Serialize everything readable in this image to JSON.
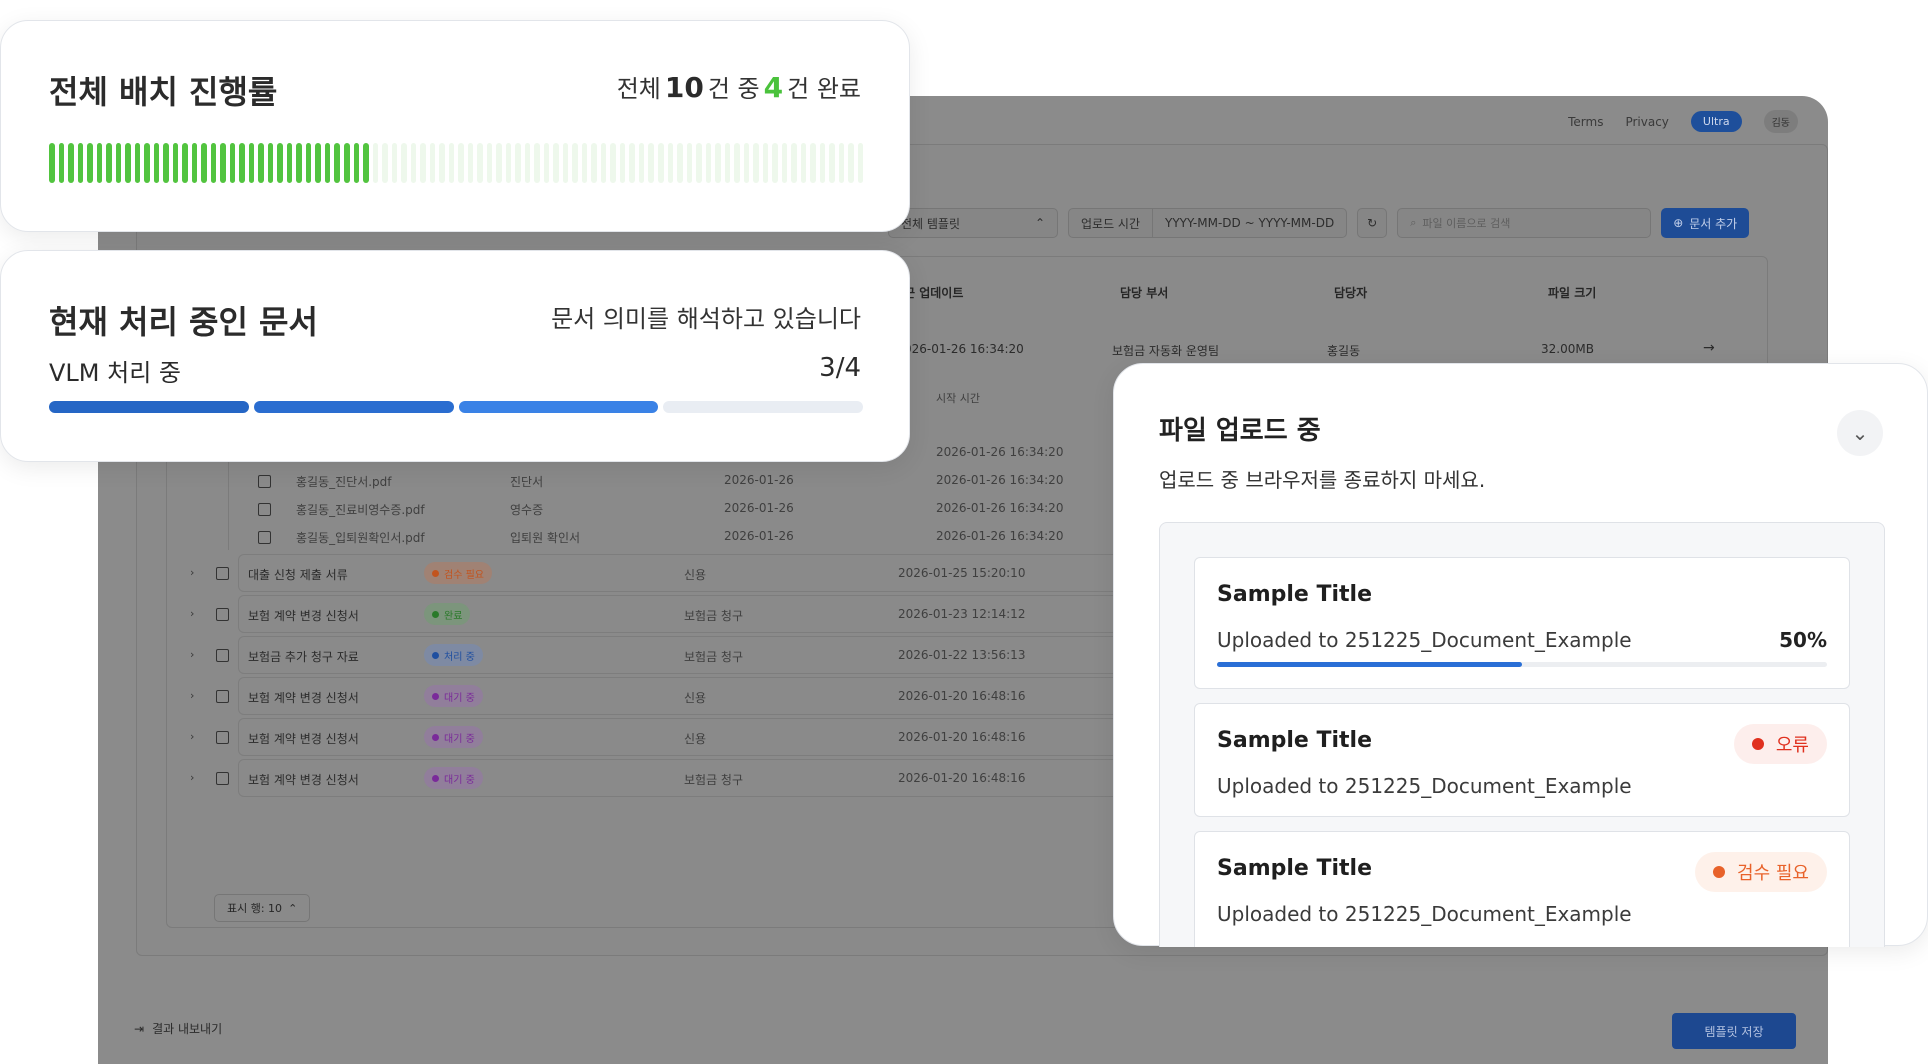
{
  "background_app": {
    "nav": {
      "terms": "Terms",
      "privacy": "Privacy",
      "plan": "Ultra",
      "user": "김동"
    },
    "filters": {
      "template": "전체 템플릿",
      "date_label": "업로드 시간",
      "date_range": "YYYY-MM-DD ~ YYYY-MM-DD",
      "search_placeholder": "파일 이름으로 검색",
      "add_button": "문서 추가"
    },
    "columns": [
      "근 업데이트",
      "담당 부서",
      "담당자",
      "파일 크기"
    ],
    "expanded_row": {
      "updated": "026-01-26 16:34:20",
      "dept": "보험금 자동화 운영팀",
      "owner": "홍길동",
      "size": "32.00MB"
    },
    "sub_header": "시작 시간",
    "sub_files": [
      {
        "name": "",
        "type": "",
        "date": "",
        "start": "2026-01-26 16:34:20"
      },
      {
        "name": "홍길동_진단서.pdf",
        "type": "진단서",
        "date": "2026-01-26",
        "start": "2026-01-26 16:34:20"
      },
      {
        "name": "홍길동_진료비영수증.pdf",
        "type": "영수증",
        "date": "2026-01-26",
        "start": "2026-01-26 16:34:20"
      },
      {
        "name": "홍길동_입퇴원확인서.pdf",
        "type": "입퇴원 확인서",
        "date": "2026-01-26",
        "start": "2026-01-26 16:34:20"
      }
    ],
    "rows": [
      {
        "title": "대출 신청 제출 서류",
        "status": "검수 필요",
        "category": "신용",
        "time": "2026-01-25 15:20:10",
        "status_color": "#c2541e",
        "status_bg": "#a08274"
      },
      {
        "title": "보험 계약 변경 신청서",
        "status": "완료",
        "category": "보험금 청구",
        "time": "2026-01-23 12:14:12",
        "status_color": "#2a7a2a",
        "status_bg": "#7c957c"
      },
      {
        "title": "보험금 추가 청구 자료",
        "status": "처리 중",
        "category": "보험금 청구",
        "time": "2026-01-22 13:56:13",
        "status_color": "#1f4fa0",
        "status_bg": "#7e8aa3"
      },
      {
        "title": "보험 계약 변경 신청서",
        "status": "대기 중",
        "category": "신용",
        "time": "2026-01-20 16:48:16",
        "status_color": "#7a2a9a",
        "status_bg": "#917e9b"
      },
      {
        "title": "보험 계약 변경 신청서",
        "status": "대기 중",
        "category": "신용",
        "time": "2026-01-20 16:48:16",
        "status_color": "#7a2a9a",
        "status_bg": "#917e9b"
      },
      {
        "title": "보험 계약 변경 신청서",
        "status": "대기 중",
        "category": "보험금 청구",
        "time": "2026-01-20 16:48:16",
        "status_color": "#7a2a9a",
        "status_bg": "#917e9b"
      }
    ],
    "rows_per_page": "표시 행: 10",
    "export_label": "결과 내보내기",
    "save_template": "템플릿 저장"
  },
  "batch_progress": {
    "title": "전체 배치 진행률",
    "summary_prefix": "전체",
    "total": "10",
    "summary_mid": "건 중",
    "done": "4",
    "summary_suffix": "건 완료",
    "segments_total": 100,
    "segments_done": 40,
    "done_color": "#52c43f",
    "pending_color": "#eef8ec"
  },
  "current_doc": {
    "title": "현재 처리 중인 문서",
    "message": "문서 의미를 해석하고 있습니다",
    "stage": "VLM 처리 중",
    "step_text": "3/4",
    "steps_total": 4,
    "steps_done": 3,
    "step_colors": [
      "#2566c5",
      "#2a6dd0",
      "#3a82e6"
    ],
    "step_pending": "#e9edf3"
  },
  "upload": {
    "title": "파일 업로드 중",
    "subtitle": "업로드 중 브라우저를 종료하지 마세요.",
    "items": [
      {
        "title": "Sample Title",
        "dest": "Uploaded to 251225_Document_Example",
        "percent_text": "50%",
        "progress": 0.5
      },
      {
        "title": "Sample Title",
        "dest": "Uploaded to 251225_Document_Example",
        "status": "오류",
        "status_color": "#e0301e",
        "status_bg": "#fdeeec"
      },
      {
        "title": "Sample Title",
        "dest": "Uploaded to 251225_Document_Example",
        "status": "검수 필요",
        "status_color": "#e8622a",
        "status_bg": "#fef1ea"
      }
    ]
  }
}
